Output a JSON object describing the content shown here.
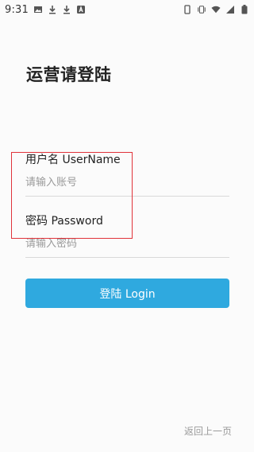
{
  "status_bar": {
    "time": "9:31",
    "left_icons": [
      "image-icon",
      "download-icon",
      "download-icon",
      "app-a-icon"
    ],
    "right_icons": [
      "portrait-lock-icon",
      "vibrate-icon",
      "wifi-icon",
      "signal-icon",
      "battery-icon"
    ]
  },
  "page": {
    "title": "运营请登陆"
  },
  "form": {
    "username": {
      "label": "用户名 UserName",
      "placeholder": "请输入账号",
      "value": ""
    },
    "password": {
      "label": "密码 Password",
      "placeholder": "请输入密码",
      "value": ""
    }
  },
  "actions": {
    "login_label": "登陆 Login",
    "back_label": "返回上一页"
  },
  "colors": {
    "primary": "#2fa9df",
    "highlight": "#e0333a",
    "placeholder": "#9a9a9a",
    "divider": "#d9d9d9",
    "background": "#fbfbfb"
  }
}
